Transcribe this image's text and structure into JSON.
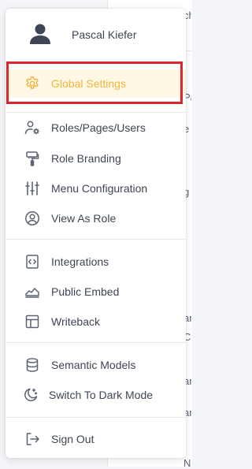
{
  "user": {
    "name": "Pascal Kiefer"
  },
  "menu": {
    "items": [
      {
        "label": "Global Settings",
        "icon": "gear-icon",
        "active": true
      },
      {
        "label": "Roles/Pages/Users",
        "icon": "user-gear-icon"
      },
      {
        "label": "Role Branding",
        "icon": "paint-roller-icon"
      },
      {
        "label": "Menu Configuration",
        "icon": "sliders-icon"
      },
      {
        "label": "View As Role",
        "icon": "user-circle-icon"
      },
      {
        "label": "Integrations",
        "icon": "code-file-icon"
      },
      {
        "label": "Public Embed",
        "icon": "area-chart-icon"
      },
      {
        "label": "Writeback",
        "icon": "table-icon"
      },
      {
        "label": "Semantic Models",
        "icon": "database-icon"
      },
      {
        "label": "Switch To Dark Mode",
        "icon": "moon-stars-icon"
      },
      {
        "label": "Sign Out",
        "icon": "sign-out-icon"
      }
    ]
  },
  "background": {
    "fragments": [
      "ch",
      "Pa",
      "e",
      "g",
      "an",
      "C",
      "an",
      "an",
      "N"
    ]
  },
  "colors": {
    "accent": "#f0b43c",
    "active_bg": "#fff8e5",
    "highlight_border": "#d9262c",
    "text": "#3e4554",
    "icon": "#5b6474"
  }
}
